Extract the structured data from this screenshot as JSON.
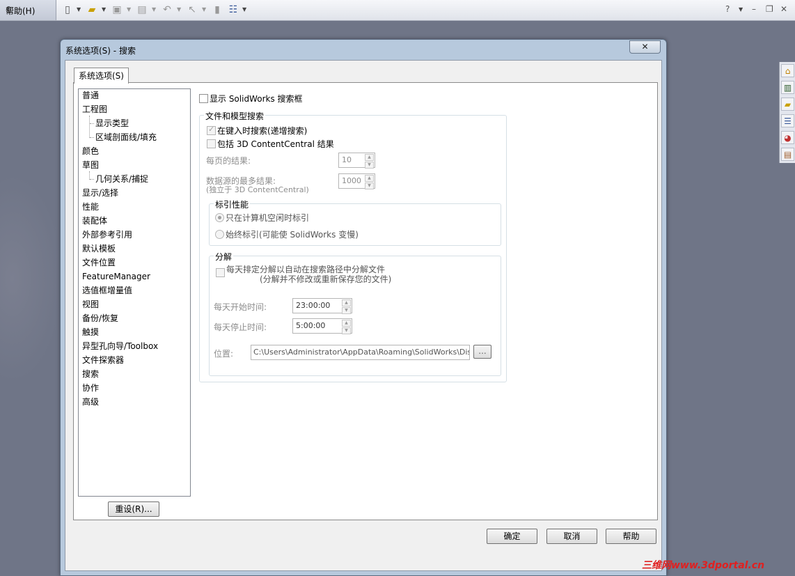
{
  "toolbar": {
    "help_menu": "帮助(H)",
    "help_btn": "?"
  },
  "dialog": {
    "title": "系统选项(S) - 搜索",
    "close": "✕",
    "tab": "系统选项(S)",
    "tree": [
      {
        "label": "普通",
        "level": 0
      },
      {
        "label": "工程图",
        "level": 0
      },
      {
        "label": "显示类型",
        "level": 1
      },
      {
        "label": "区域剖面线/填充",
        "level": 1
      },
      {
        "label": "颜色",
        "level": 0
      },
      {
        "label": "草图",
        "level": 0
      },
      {
        "label": "几何关系/捕捉",
        "level": 1
      },
      {
        "label": "显示/选择",
        "level": 0
      },
      {
        "label": "性能",
        "level": 0
      },
      {
        "label": "装配体",
        "level": 0
      },
      {
        "label": "外部参考引用",
        "level": 0
      },
      {
        "label": "默认模板",
        "level": 0
      },
      {
        "label": "文件位置",
        "level": 0
      },
      {
        "label": "FeatureManager",
        "level": 0
      },
      {
        "label": "选值框增量值",
        "level": 0
      },
      {
        "label": "视图",
        "level": 0
      },
      {
        "label": "备份/恢复",
        "level": 0
      },
      {
        "label": "触摸",
        "level": 0
      },
      {
        "label": "异型孔向导/Toolbox",
        "level": 0
      },
      {
        "label": "文件探索器",
        "level": 0
      },
      {
        "label": "搜索",
        "level": 0
      },
      {
        "label": "协作",
        "level": 0
      },
      {
        "label": "高级",
        "level": 0
      }
    ],
    "reset_button": "重设(R)...",
    "show_search_box": "显示 SolidWorks 搜索框",
    "file_search": {
      "title": "文件和模型搜索",
      "incremental": "在键入时搜索(递增搜索)",
      "include_3dcc": "包括 3D ContentCentral 结果",
      "per_page_label": "每页的结果:",
      "per_page_value": "10",
      "max_results_label": "数据源的最多结果:",
      "max_results_sub": "(独立于 3D ContentCentral)",
      "max_results_value": "1000"
    },
    "index": {
      "title": "标引性能",
      "idle": "只在计算机空闲时标引",
      "always": "始终标引(可能使 SolidWorks 变慢)"
    },
    "dissection": {
      "title": "分解",
      "schedule": "每天排定分解以自动在搜索路径中分解文件",
      "schedule_sub": "(分解并不修改或重新保存您的文件)",
      "start_label": "每天开始时间:",
      "start_value": "23:00:00",
      "stop_label": "每天停止时间:",
      "stop_value": "5:00:00",
      "location_label": "位置:",
      "location_value": "C:\\Users\\Administrator\\AppData\\Roaming\\SolidWorks\\Dissection",
      "browse": "..."
    },
    "ok": "确定",
    "cancel": "取消",
    "help": "帮助"
  },
  "watermark": "三维网www.3dportal.cn"
}
